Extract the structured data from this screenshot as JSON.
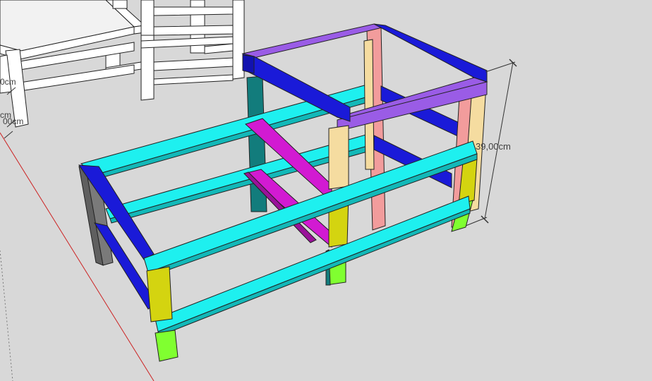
{
  "app": {
    "viewport_name": "3D modeling viewport"
  },
  "dimensions": {
    "height_label": "39,00cm",
    "left_label_1": "0cm",
    "left_label_2": "cm",
    "left_label_3": "00cm"
  },
  "colors": {
    "background": "#d8d8d8",
    "frame_blue": "#1a1ad8",
    "rail_cyan": "#1ef0ef",
    "brace_magenta": "#d21ad2",
    "top_lilac": "#9a5ce6",
    "post_pink": "#f29c9c",
    "post_cream": "#f5dca0",
    "post_yellow": "#d4d410",
    "foot_lime": "#80ff30",
    "post_teal": "#127c7c",
    "post_gray": "#7a7a7a",
    "axis_red": "#cc2222"
  },
  "icons": {
    "dimension_arrow": "dimension-arrow-icon"
  }
}
